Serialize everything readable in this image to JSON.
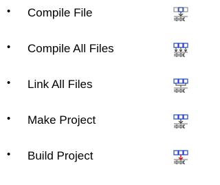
{
  "items": [
    {
      "label": "Compile File",
      "icon": "compile-file-icon",
      "bullet": "•"
    },
    {
      "label": "Compile All Files",
      "icon": "compile-all-files-icon",
      "bullet": "•"
    },
    {
      "label": "Link All Files",
      "icon": "link-all-files-icon",
      "bullet": "•"
    },
    {
      "label": "Make Project",
      "icon": "make-project-icon",
      "bullet": "•"
    },
    {
      "label": "Build Project",
      "icon": "build-project-icon",
      "bullet": "•"
    }
  ],
  "colors": {
    "icon_blue": "#1f3fbf",
    "icon_dark": "#3a3a3a",
    "icon_gray": "#7a7a7a",
    "build_red": "#d01010"
  }
}
